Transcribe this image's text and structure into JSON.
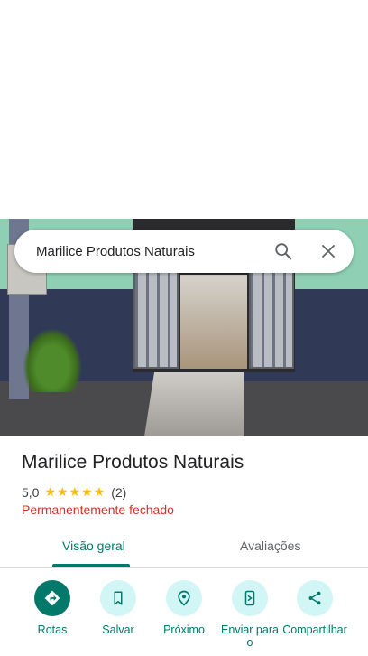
{
  "search": {
    "query": "Marilice Produtos Naturais"
  },
  "place": {
    "name": "Marilice Produtos Naturais",
    "rating": "5,0",
    "stars": "★★★★★",
    "reviews_count": "(2)",
    "status": "Permanentemente fechado"
  },
  "tabs": {
    "overview": "Visão geral",
    "reviews": "Avaliações"
  },
  "actions": {
    "directions": "Rotas",
    "save": "Salvar",
    "nearby": "Próximo",
    "send": "Enviar para o",
    "share": "Compartilhar"
  },
  "colors": {
    "accent": "#00796b",
    "closed": "#d93025",
    "star": "#fbbc04"
  }
}
